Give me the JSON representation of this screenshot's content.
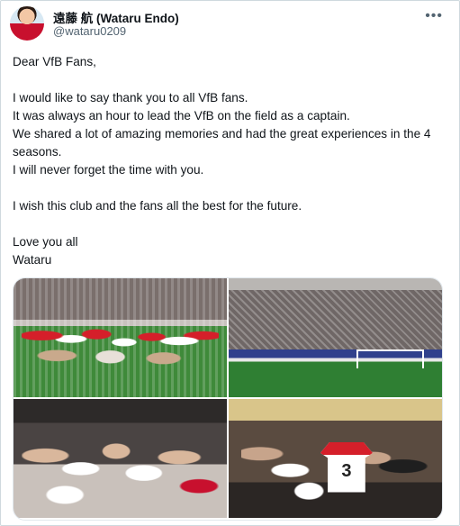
{
  "author": {
    "name": "遠藤 航 (Wataru Endo)",
    "handle": "@wataru0209",
    "more_icon": "more-horizontal-icon"
  },
  "tweet": {
    "greeting": "Dear VfB Fans,",
    "lines": [
      "I would like to say thank you to all VfB fans.",
      "It was always an hour to lead the VfB on the field as a captain.",
      "We shared a lot of amazing memories and had the great experiences in the 4 seasons.",
      "I will never forget the time with you.",
      "I wish this club and the fans all the best for the future.",
      "Love you all",
      "Wataru"
    ]
  },
  "media": {
    "jersey_number": "3"
  }
}
